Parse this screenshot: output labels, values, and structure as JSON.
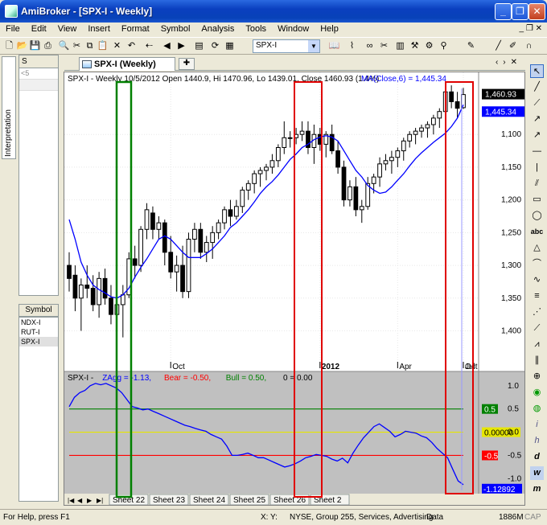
{
  "window": {
    "title": "AmiBroker - [SPX-I - Weekly]",
    "minimize": "_",
    "restore": "❐",
    "close": "✕"
  },
  "menu": [
    "File",
    "Edit",
    "View",
    "Insert",
    "Format",
    "Symbol",
    "Analysis",
    "Tools",
    "Window",
    "Help"
  ],
  "toolbar": {
    "symbol_value": "SPX-I"
  },
  "left_panel": {
    "tab_label": "Interpretation",
    "box_header": "S",
    "box_row": "<5",
    "symbol_header": "Symbol",
    "symbols": [
      "NDX-I",
      "RUT-I",
      "SPX-I"
    ],
    "selected_symbol": "SPX-I"
  },
  "doc_tab": {
    "label": "SPX-I (Weekly)",
    "new_tab": "✚"
  },
  "chart": {
    "price_header": "SPX-I - Weekly 10/5/2012 Open 1440.9, Hi 1470.96, Lo 1439.01, Close 1460.93 (1.4%)",
    "ma_header": "MA(Close,6) = 1,445.34",
    "x_labels": [
      "Oct",
      "2012",
      "Apr",
      "Jul",
      "Oct"
    ],
    "y_ticks": [
      "1,400",
      "1,350",
      "1,300",
      "1,250",
      "1,200",
      "1,150",
      "1,100"
    ],
    "last_close_label": "1,460.93",
    "last_ma_label": "1,445.34",
    "ind_header_sym": "SPX-I -",
    "ind_header_zag": "ZAgg = -1.13,",
    "ind_header_bear": "Bear = -0.50,",
    "ind_header_bull": "Bull = 0.50,",
    "ind_header_zero": "0 = 0.00",
    "ind_y_ticks": [
      "1.0",
      "0.5",
      "0.0",
      "-0.5",
      "-1.0"
    ],
    "ind_bull_label": "0.5",
    "ind_zero_label": "0.00000",
    "ind_bear_label": "-0.5",
    "ind_last_label": "-1.12892",
    "colors": {
      "price_ma": "#0000ff",
      "zagg": "#0000ff",
      "bull": "#008000",
      "bear": "#ff0000",
      "zero": "#e6e600",
      "green_box": "#008000",
      "red_box": "#e00000"
    }
  },
  "chart_data": [
    {
      "type": "candlestick",
      "title": "SPX-I - Weekly",
      "ylim": [
        1065,
        1485
      ],
      "y_ticks": [
        1100,
        1150,
        1200,
        1250,
        1300,
        1350,
        1400
      ],
      "candles": [
        [
          1200,
          1220,
          1160,
          1180
        ],
        [
          1185,
          1200,
          1130,
          1150
        ],
        [
          1150,
          1180,
          1100,
          1170
        ],
        [
          1170,
          1200,
          1150,
          1165
        ],
        [
          1165,
          1185,
          1130,
          1140
        ],
        [
          1140,
          1190,
          1120,
          1180
        ],
        [
          1180,
          1195,
          1140,
          1150
        ],
        [
          1150,
          1170,
          1110,
          1125
        ],
        [
          1125,
          1150,
          1080,
          1140
        ],
        [
          1140,
          1170,
          1090,
          1155
        ],
        [
          1155,
          1220,
          1150,
          1210
        ],
        [
          1210,
          1230,
          1180,
          1200
        ],
        [
          1200,
          1260,
          1190,
          1255
        ],
        [
          1255,
          1295,
          1240,
          1285
        ],
        [
          1280,
          1290,
          1240,
          1255
        ],
        [
          1255,
          1275,
          1240,
          1265
        ],
        [
          1265,
          1270,
          1200,
          1220
        ],
        [
          1220,
          1245,
          1180,
          1190
        ],
        [
          1190,
          1215,
          1160,
          1200
        ],
        [
          1200,
          1230,
          1150,
          1160
        ],
        [
          1160,
          1250,
          1150,
          1240
        ],
        [
          1240,
          1265,
          1220,
          1255
        ],
        [
          1255,
          1265,
          1210,
          1220
        ],
        [
          1220,
          1245,
          1205,
          1235
        ],
        [
          1235,
          1260,
          1210,
          1250
        ],
        [
          1250,
          1270,
          1240,
          1265
        ],
        [
          1265,
          1290,
          1255,
          1285
        ],
        [
          1285,
          1300,
          1260,
          1275
        ],
        [
          1275,
          1300,
          1270,
          1290
        ],
        [
          1290,
          1320,
          1280,
          1315
        ],
        [
          1315,
          1330,
          1300,
          1325
        ],
        [
          1325,
          1345,
          1310,
          1340
        ],
        [
          1340,
          1350,
          1320,
          1345
        ],
        [
          1345,
          1355,
          1330,
          1350
        ],
        [
          1350,
          1370,
          1340,
          1360
        ],
        [
          1360,
          1385,
          1350,
          1380
        ],
        [
          1380,
          1420,
          1370,
          1395
        ],
        [
          1395,
          1405,
          1380,
          1395
        ],
        [
          1395,
          1410,
          1385,
          1400
        ],
        [
          1400,
          1420,
          1390,
          1405
        ],
        [
          1405,
          1420,
          1370,
          1380
        ],
        [
          1380,
          1415,
          1355,
          1400
        ],
        [
          1400,
          1410,
          1375,
          1385
        ],
        [
          1385,
          1405,
          1365,
          1400
        ],
        [
          1400,
          1415,
          1370,
          1375
        ],
        [
          1375,
          1390,
          1340,
          1350
        ],
        [
          1350,
          1360,
          1290,
          1300
        ],
        [
          1300,
          1330,
          1290,
          1320
        ],
        [
          1320,
          1335,
          1275,
          1285
        ],
        [
          1285,
          1300,
          1265,
          1290
        ],
        [
          1290,
          1335,
          1285,
          1325
        ],
        [
          1325,
          1340,
          1310,
          1335
        ],
        [
          1335,
          1365,
          1320,
          1355
        ],
        [
          1355,
          1370,
          1345,
          1360
        ],
        [
          1360,
          1375,
          1340,
          1365
        ],
        [
          1365,
          1380,
          1350,
          1375
        ],
        [
          1375,
          1395,
          1360,
          1390
        ],
        [
          1390,
          1405,
          1380,
          1400
        ],
        [
          1400,
          1410,
          1385,
          1405
        ],
        [
          1405,
          1415,
          1395,
          1410
        ],
        [
          1410,
          1420,
          1395,
          1415
        ],
        [
          1415,
          1430,
          1400,
          1425
        ],
        [
          1425,
          1440,
          1410,
          1435
        ],
        [
          1435,
          1475,
          1430,
          1465
        ],
        [
          1465,
          1475,
          1440,
          1450
        ],
        [
          1450,
          1465,
          1425,
          1440
        ],
        [
          1440.9,
          1470.96,
          1439.01,
          1460.93
        ]
      ],
      "ma_close_6": [
        1270,
        1240,
        1205,
        1185,
        1170,
        1163,
        1158,
        1152,
        1150,
        1155,
        1165,
        1182,
        1197,
        1210,
        1225,
        1240,
        1245,
        1240,
        1230,
        1220,
        1212,
        1212,
        1212,
        1218,
        1225,
        1235,
        1245,
        1258,
        1265,
        1275,
        1285,
        1297,
        1310,
        1320,
        1328,
        1338,
        1350,
        1362,
        1370,
        1380,
        1385,
        1392,
        1396,
        1398,
        1396,
        1390,
        1375,
        1360,
        1345,
        1335,
        1322,
        1315,
        1310,
        1312,
        1320,
        1330,
        1340,
        1352,
        1363,
        1372,
        1380,
        1388,
        1395,
        1402,
        1412,
        1425,
        1445.34
      ],
      "last_close": 1460.93,
      "last_ma": 1445.34
    },
    {
      "type": "line",
      "title": "ZAgg",
      "ylim": [
        -1.15,
        1.1
      ],
      "y_ticks": [
        1.0,
        0.5,
        0.0,
        -0.5,
        -1.0
      ],
      "series": [
        {
          "name": "ZAgg",
          "values": [
            0.55,
            0.75,
            0.85,
            0.9,
            1.0,
            1.05,
            1.02,
            1.05,
            1.0,
            0.95,
            0.85,
            0.7,
            0.55,
            0.52,
            0.48,
            0.5,
            0.45,
            0.4,
            0.35,
            0.3,
            0.25,
            0.2,
            0.15,
            0.12,
            0.08,
            0.05,
            0.02,
            -0.05,
            -0.1,
            -0.15,
            -0.3,
            -0.5,
            -0.5,
            -0.48,
            -0.45,
            -0.5,
            -0.55,
            -0.55,
            -0.6,
            -0.65,
            -0.7,
            -0.75,
            -0.72,
            -0.68,
            -0.62,
            -0.55,
            -0.52,
            -0.48,
            -0.5,
            -0.52,
            -0.58,
            -0.62,
            -0.56,
            -0.66,
            -0.45,
            -0.28,
            -0.12,
            0.0,
            0.12,
            0.18,
            0.1,
            0.02,
            -0.1,
            -0.05,
            0.02,
            0.0,
            -0.02,
            -0.08,
            -0.12,
            -0.22,
            -0.35,
            -0.45,
            -0.55,
            -0.8,
            -1.05,
            -1.13
          ]
        },
        {
          "name": "Bear",
          "values": [
            -0.5
          ]
        },
        {
          "name": "Bull",
          "values": [
            0.5
          ]
        },
        {
          "name": "0",
          "values": [
            0.0
          ]
        }
      ],
      "last_value": -1.12892
    }
  ],
  "sheets": [
    "Sheet 22",
    "Sheet 23",
    "Sheet 24",
    "Sheet 25",
    "Sheet 26",
    "Sheet 2"
  ],
  "status": {
    "help": "For Help, press F1",
    "xy": "X:    Y:",
    "info": "NYSE, Group 255, Services, Advertising",
    "data": "Data",
    "mem": "1886M",
    "cap": "CAP"
  }
}
